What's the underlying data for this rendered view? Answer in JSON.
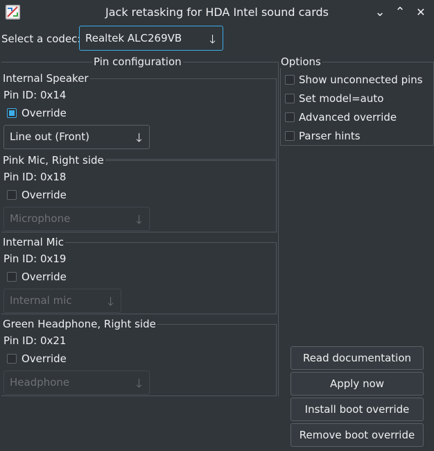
{
  "window": {
    "title": "Jack retasking for HDA Intel sound cards",
    "app_icon": "hdajackretask-icon",
    "controls": {
      "minimize": "⌄",
      "maximize": "⌃",
      "close": "✕"
    }
  },
  "codec": {
    "label": "Select a codec:",
    "selected": "Realtek ALC269VB"
  },
  "pin_configuration": {
    "title": "Pin configuration",
    "pins": [
      {
        "name": "Internal Speaker",
        "pin_id": "Pin ID: 0x14",
        "override_label": "Override",
        "override_checked": true,
        "selected": "Line out (Front)",
        "enabled": true
      },
      {
        "name": "Pink Mic, Right side",
        "pin_id": "Pin ID: 0x18",
        "override_label": "Override",
        "override_checked": false,
        "selected": "Microphone",
        "enabled": false
      },
      {
        "name": "Internal Mic",
        "pin_id": "Pin ID: 0x19",
        "override_label": "Override",
        "override_checked": false,
        "selected": "Internal mic",
        "enabled": false
      },
      {
        "name": "Green Headphone, Right side",
        "pin_id": "Pin ID: 0x21",
        "override_label": "Override",
        "override_checked": false,
        "selected": "Headphone",
        "enabled": false
      }
    ]
  },
  "options": {
    "title": "Options",
    "items": [
      {
        "label": "Show unconnected pins",
        "checked": false
      },
      {
        "label": "Set model=auto",
        "checked": false
      },
      {
        "label": "Advanced override",
        "checked": false
      },
      {
        "label": "Parser hints",
        "checked": false
      }
    ]
  },
  "buttons": {
    "read_docs": "Read documentation",
    "apply_now": "Apply now",
    "install_boot": "Install boot override",
    "remove_boot": "Remove boot override"
  },
  "colors": {
    "background": "#31363b",
    "text": "#eff0f1",
    "accent": "#3daee9",
    "disabled_text": "#6e7175"
  },
  "icons": {
    "combo_arrow": "🡓",
    "combo_arrow_name": "arrow-down-icon"
  }
}
